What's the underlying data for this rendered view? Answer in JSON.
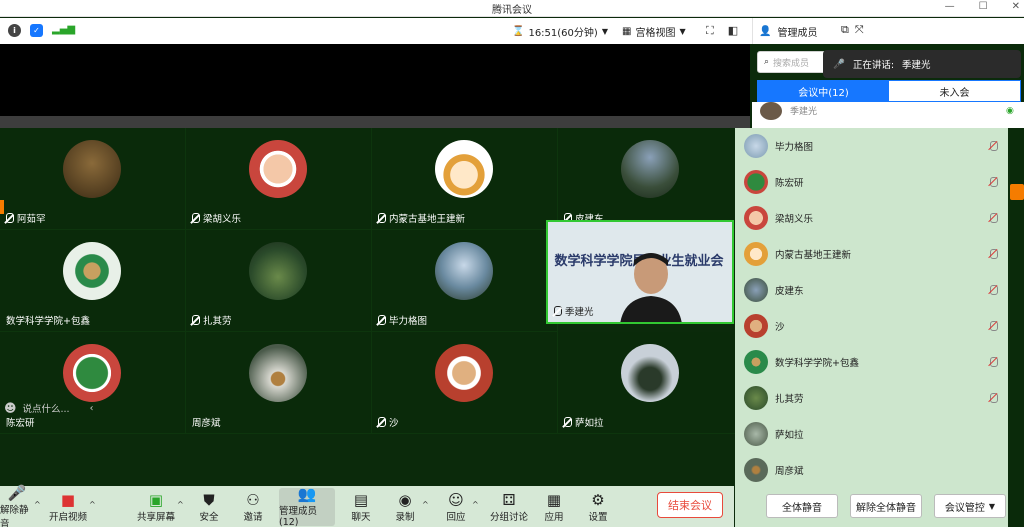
{
  "window": {
    "title": "腾讯会议"
  },
  "infobar": {
    "timer": "16:51(60分钟)",
    "view_label": "宫格视图"
  },
  "colors": {
    "accent": "#1677ff",
    "tile_bg": "#0a2a0a",
    "panel_bg": "#cde6cd",
    "end": "#e84a3c",
    "speaker_border": "#32c832"
  },
  "tiles": [
    {
      "name": "阿茹罕",
      "avatar_color": "#5b3f22"
    },
    {
      "name": "梁胡义乐",
      "avatar_color": "#c9463d"
    },
    {
      "name": "内蒙古基地王建新",
      "avatar_color": "#e3c06a"
    },
    {
      "name": "皮建东",
      "avatar_color": "#3a4e3a"
    },
    {
      "name": "数学科学学院+包鑫",
      "avatar_color": "#2a8a4a"
    },
    {
      "name": "扎其劳",
      "avatar_color": "#3f6b3a"
    },
    {
      "name": "毕力格图",
      "avatar_color": "#6a8aa0"
    },
    {
      "name": "季建光",
      "avatar_color": "#dfe8ec"
    },
    {
      "name": "陈宏研",
      "avatar_color": "#2f8a3f"
    },
    {
      "name": "周彦斌",
      "avatar_color": "#4a5a4a"
    },
    {
      "name": "沙",
      "avatar_color": "#b8402e"
    },
    {
      "name": "萨如拉",
      "avatar_color": "#8a9aa8"
    }
  ],
  "speaker_banner": "数学科学学院届毕业生就业会",
  "chat_placeholder": "说点什么...",
  "toolbar": {
    "mute": "解除静音",
    "video": "开启视频",
    "share": "共享屏幕",
    "security": "安全",
    "invite": "邀请",
    "members": "管理成员(12)",
    "chat": "聊天",
    "record": "录制",
    "react": "回应",
    "breakout": "分组讨论",
    "apps": "应用",
    "settings": "设置",
    "end": "结束会议"
  },
  "panel": {
    "title": "管理成员",
    "search_placeholder": "搜索成员",
    "speaking_label": "正在讲话:",
    "speaking_name": "季建光",
    "tab_in": "会议中(12)",
    "tab_out": "未入会",
    "first_member": "季建光",
    "members": [
      {
        "name": "毕力格图",
        "avatar_color": "#7a9ab0"
      },
      {
        "name": "陈宏研",
        "avatar_color": "#2f8a3f"
      },
      {
        "name": "梁胡义乐",
        "avatar_color": "#c9463d"
      },
      {
        "name": "内蒙古基地王建新",
        "avatar_color": "#e3a03a"
      },
      {
        "name": "皮建东",
        "avatar_color": "#3a4e3a"
      },
      {
        "name": "沙",
        "avatar_color": "#b8402e"
      },
      {
        "name": "数学科学学院+包鑫",
        "avatar_color": "#2a8a4a"
      },
      {
        "name": "扎其劳",
        "avatar_color": "#3f6b3a"
      },
      {
        "name": "萨如拉",
        "avatar_color": "#6a7a68"
      },
      {
        "name": "周彦斌",
        "avatar_color": "#5a6a5a"
      }
    ],
    "mute_all": "全体静音",
    "unmute_all": "解除全体静音",
    "controls": "会议管控"
  }
}
